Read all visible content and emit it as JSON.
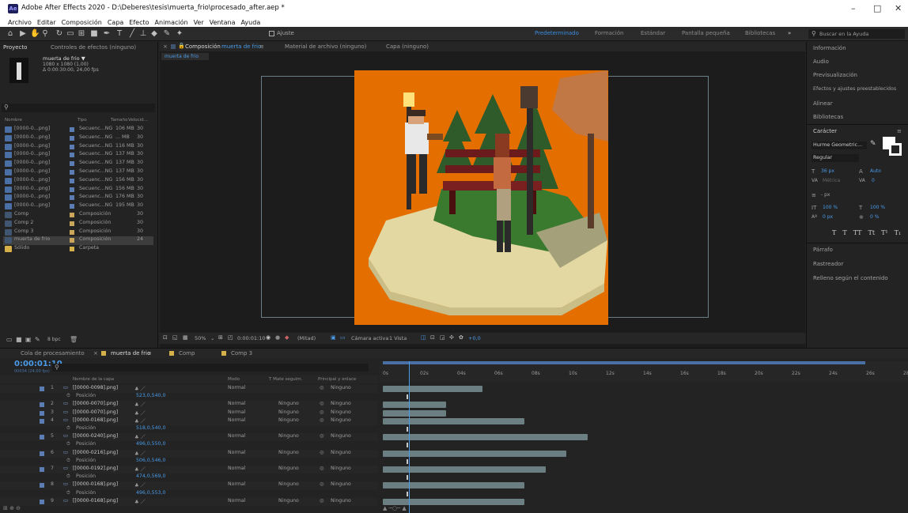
{
  "titlebar": {
    "app_icon": "Ae",
    "title": "Adobe After Effects 2020 - D:\\Deberes\\tesis\\muerta_frio\\procesado_after.aep *",
    "minimize": "–",
    "maximize": "□",
    "close": "✕"
  },
  "menu": [
    "Archivo",
    "Editar",
    "Composición",
    "Capa",
    "Efecto",
    "Animación",
    "Ver",
    "Ventana",
    "Ayuda"
  ],
  "toolbar": {
    "align_label": "Ajuste",
    "workspaces": [
      "Predeterminado",
      "Formación",
      "Estándar",
      "Pantalla pequeña",
      "Bibliotecas"
    ],
    "active_workspace": "Predeterminado",
    "search_placeholder": "Buscar en la Ayuda",
    "more": "»"
  },
  "project": {
    "tab": "Proyecto",
    "tab2": "Controles de efectos (ninguno)",
    "comp_name": "muerta de frio ▼",
    "comp_info1": "1080 x 1080 (1,00)",
    "comp_info2": "Δ 0:00:30:00, 24,00 fps",
    "search_icon": "search-icon",
    "columns": [
      "Nombre",
      "Tipo",
      "Tamaño",
      "Velocid..."
    ],
    "items": [
      {
        "name": "[0000-0...png]",
        "type": "Secuenc...NG",
        "size": "106 MB",
        "fps": "30",
        "kind": "seq"
      },
      {
        "name": "[0000-0...png]",
        "type": "Secuenc...NG",
        "size": "... MB",
        "fps": "30",
        "kind": "seq"
      },
      {
        "name": "[0000-0...png]",
        "type": "Secuenc...NG",
        "size": "116 MB",
        "fps": "30",
        "kind": "seq"
      },
      {
        "name": "[0000-0...png]",
        "type": "Secuenc...NG",
        "size": "137 MB",
        "fps": "30",
        "kind": "seq"
      },
      {
        "name": "[0000-0...png]",
        "type": "Secuenc...NG",
        "size": "137 MB",
        "fps": "30",
        "kind": "seq"
      },
      {
        "name": "[0000-0...png]",
        "type": "Secuenc...NG",
        "size": "137 MB",
        "fps": "30",
        "kind": "seq"
      },
      {
        "name": "[0000-0...png]",
        "type": "Secuenc...NG",
        "size": "156 MB",
        "fps": "30",
        "kind": "seq"
      },
      {
        "name": "[0000-0...png]",
        "type": "Secuenc...NG",
        "size": "156 MB",
        "fps": "30",
        "kind": "seq"
      },
      {
        "name": "[0000-0...png]",
        "type": "Secuenc...NG",
        "size": "176 MB",
        "fps": "30",
        "kind": "seq"
      },
      {
        "name": "[0000-0...png]",
        "type": "Secuenc...NG",
        "size": "195 MB",
        "fps": "30",
        "kind": "seq"
      },
      {
        "name": "Comp",
        "type": "Composición",
        "size": "",
        "fps": "30",
        "kind": "comp"
      },
      {
        "name": "Comp 2",
        "type": "Composición",
        "size": "",
        "fps": "30",
        "kind": "comp"
      },
      {
        "name": "Comp 3",
        "type": "Composición",
        "size": "",
        "fps": "30",
        "kind": "comp"
      },
      {
        "name": "muerta de frio",
        "type": "Composición",
        "size": "",
        "fps": "24",
        "kind": "comp"
      },
      {
        "name": "Sólido",
        "type": "Carpeta",
        "size": "",
        "fps": "",
        "kind": "fold"
      }
    ],
    "bpc": "8 bpc"
  },
  "viewer": {
    "tab_comp": "Composición",
    "comp_link": "muerta de frio",
    "tab_footage": "Material de archivo (ninguno)",
    "tab_layer": "Capa (ninguno)",
    "subtab": "muerta de frio",
    "zoom": "50%",
    "timecode": "0:00:01:10",
    "resolution": "(Mitad)",
    "camera": "Cámara activa",
    "views": "1 Vista",
    "exposure": "+0,0"
  },
  "right_panel": {
    "items": [
      "Información",
      "Audio",
      "Previsualización",
      "Efectos y ajustes preestablecidos",
      "Alinear",
      "Bibliotecas"
    ],
    "character": "Carácter",
    "font": "Hurme Geometric...",
    "style": "Regular",
    "font_size": "36 px",
    "leading": "Auto",
    "tracking": "Métrica",
    "kerning": "0",
    "stroke": "- px",
    "vscale": "100 %",
    "hscale": "100 %",
    "baseline": "0 px",
    "tsume": "0 %",
    "styles": [
      "T",
      "T",
      "TT",
      "Tt",
      "T¹",
      "T₁"
    ],
    "items2": [
      "Párrafo",
      "Rastreador",
      "Relleno según el contenido"
    ]
  },
  "timeline": {
    "tabs": [
      "Cola de procesamiento",
      "muerta de frio",
      "Comp",
      "Comp 3"
    ],
    "active_tab": "muerta de frio",
    "timecode": "0:00:01:10",
    "frames": "00034 (24,00 fps)",
    "col_layer": "Nombre de la capa",
    "col_mode": "Modo",
    "col_trkmat": "T  Mate seguim.",
    "col_parent": "Principal y enlace",
    "ruler": [
      "0s",
      "02s",
      "04s",
      "06s",
      "08s",
      "10s",
      "12s",
      "14s",
      "16s",
      "18s",
      "20s",
      "22s",
      "24s",
      "26s",
      "28s"
    ],
    "layers": [
      {
        "num": "1",
        "name": "[[0000-0098].png]",
        "mode": "Normal",
        "trkmat": "",
        "parent": "Ninguno",
        "prop": "Posición",
        "value": "523,0,540,0",
        "bar_end": 0.19
      },
      {
        "num": "2",
        "name": "[[0000-0070].png]",
        "mode": "Normal",
        "trkmat": "Ninguno",
        "parent": "Ninguno",
        "bar_end": 0.12
      },
      {
        "num": "3",
        "name": "[[0000-0070].png]",
        "mode": "Normal",
        "trkmat": "Ninguno",
        "parent": "Ninguno",
        "bar_end": 0.12
      },
      {
        "num": "4",
        "name": "[[0000-0168].png]",
        "mode": "Normal",
        "trkmat": "Ninguno",
        "parent": "Ninguno",
        "prop": "Posición",
        "value": "518,0,540,0",
        "bar_end": 0.27
      },
      {
        "num": "5",
        "name": "[[0000-0240].png]",
        "mode": "Normal",
        "trkmat": "Ninguno",
        "parent": "Ninguno",
        "prop": "Posición",
        "value": "496,0,550,0",
        "bar_end": 0.39
      },
      {
        "num": "6",
        "name": "[[0000-0216].png]",
        "mode": "Normal",
        "trkmat": "Ninguno",
        "parent": "Ninguno",
        "prop": "Posición",
        "value": "506,0,546,0",
        "bar_end": 0.35
      },
      {
        "num": "7",
        "name": "[[0000-0192].png]",
        "mode": "Normal",
        "trkmat": "Ninguno",
        "parent": "Ninguno",
        "prop": "Posición",
        "value": "474,0,569,0",
        "bar_end": 0.31
      },
      {
        "num": "8",
        "name": "[[0000-0168].png]",
        "mode": "Normal",
        "trkmat": "Ninguno",
        "parent": "Ninguno",
        "prop": "Posición",
        "value": "496,0,553,0",
        "bar_end": 0.27
      },
      {
        "num": "9",
        "name": "[[0000-0168].png]",
        "mode": "Normal",
        "trkmat": "Ninguno",
        "parent": "Ninguno",
        "bar_end": 0.27
      }
    ],
    "playhead_fraction": 0.05
  }
}
